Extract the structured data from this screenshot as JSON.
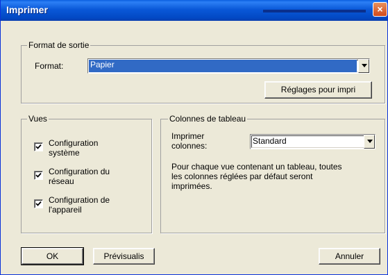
{
  "window": {
    "title": "Imprimer",
    "close_glyph": "×"
  },
  "output_format": {
    "legend": "Format de sortie",
    "format_label": "Format:",
    "format_value": "Papier",
    "settings_button": "Réglages  pour impri"
  },
  "views": {
    "legend": "Vues",
    "items": [
      {
        "label_line1": "Configuration",
        "label_line2": "système",
        "checked": true
      },
      {
        "label_line1": "Configuration du",
        "label_line2": "réseau",
        "checked": true
      },
      {
        "label_line1": "Configuration de",
        "label_line2": "l'appareil",
        "checked": true
      }
    ]
  },
  "table_columns": {
    "legend": "Colonnes de tableau",
    "print_label_line1": "Imprimer",
    "print_label_line2": "colonnes:",
    "print_value": "Standard",
    "description_line1": "Pour chaque vue contenant un tableau, toutes",
    "description_line2": "les colonnes réglées par défaut seront",
    "description_line3": "imprimées."
  },
  "buttons": {
    "ok": "OK",
    "preview": "Prévisualis",
    "cancel": "Annuler"
  },
  "icons": {
    "checkbox": "checkmark-icon",
    "dropdown": "chevron-down-icon",
    "close": "close-icon"
  },
  "colors": {
    "titlebar": "#0a58d8",
    "dialog": "#ece9d8",
    "selection": "#316ac5",
    "close": "#d24a1c"
  }
}
